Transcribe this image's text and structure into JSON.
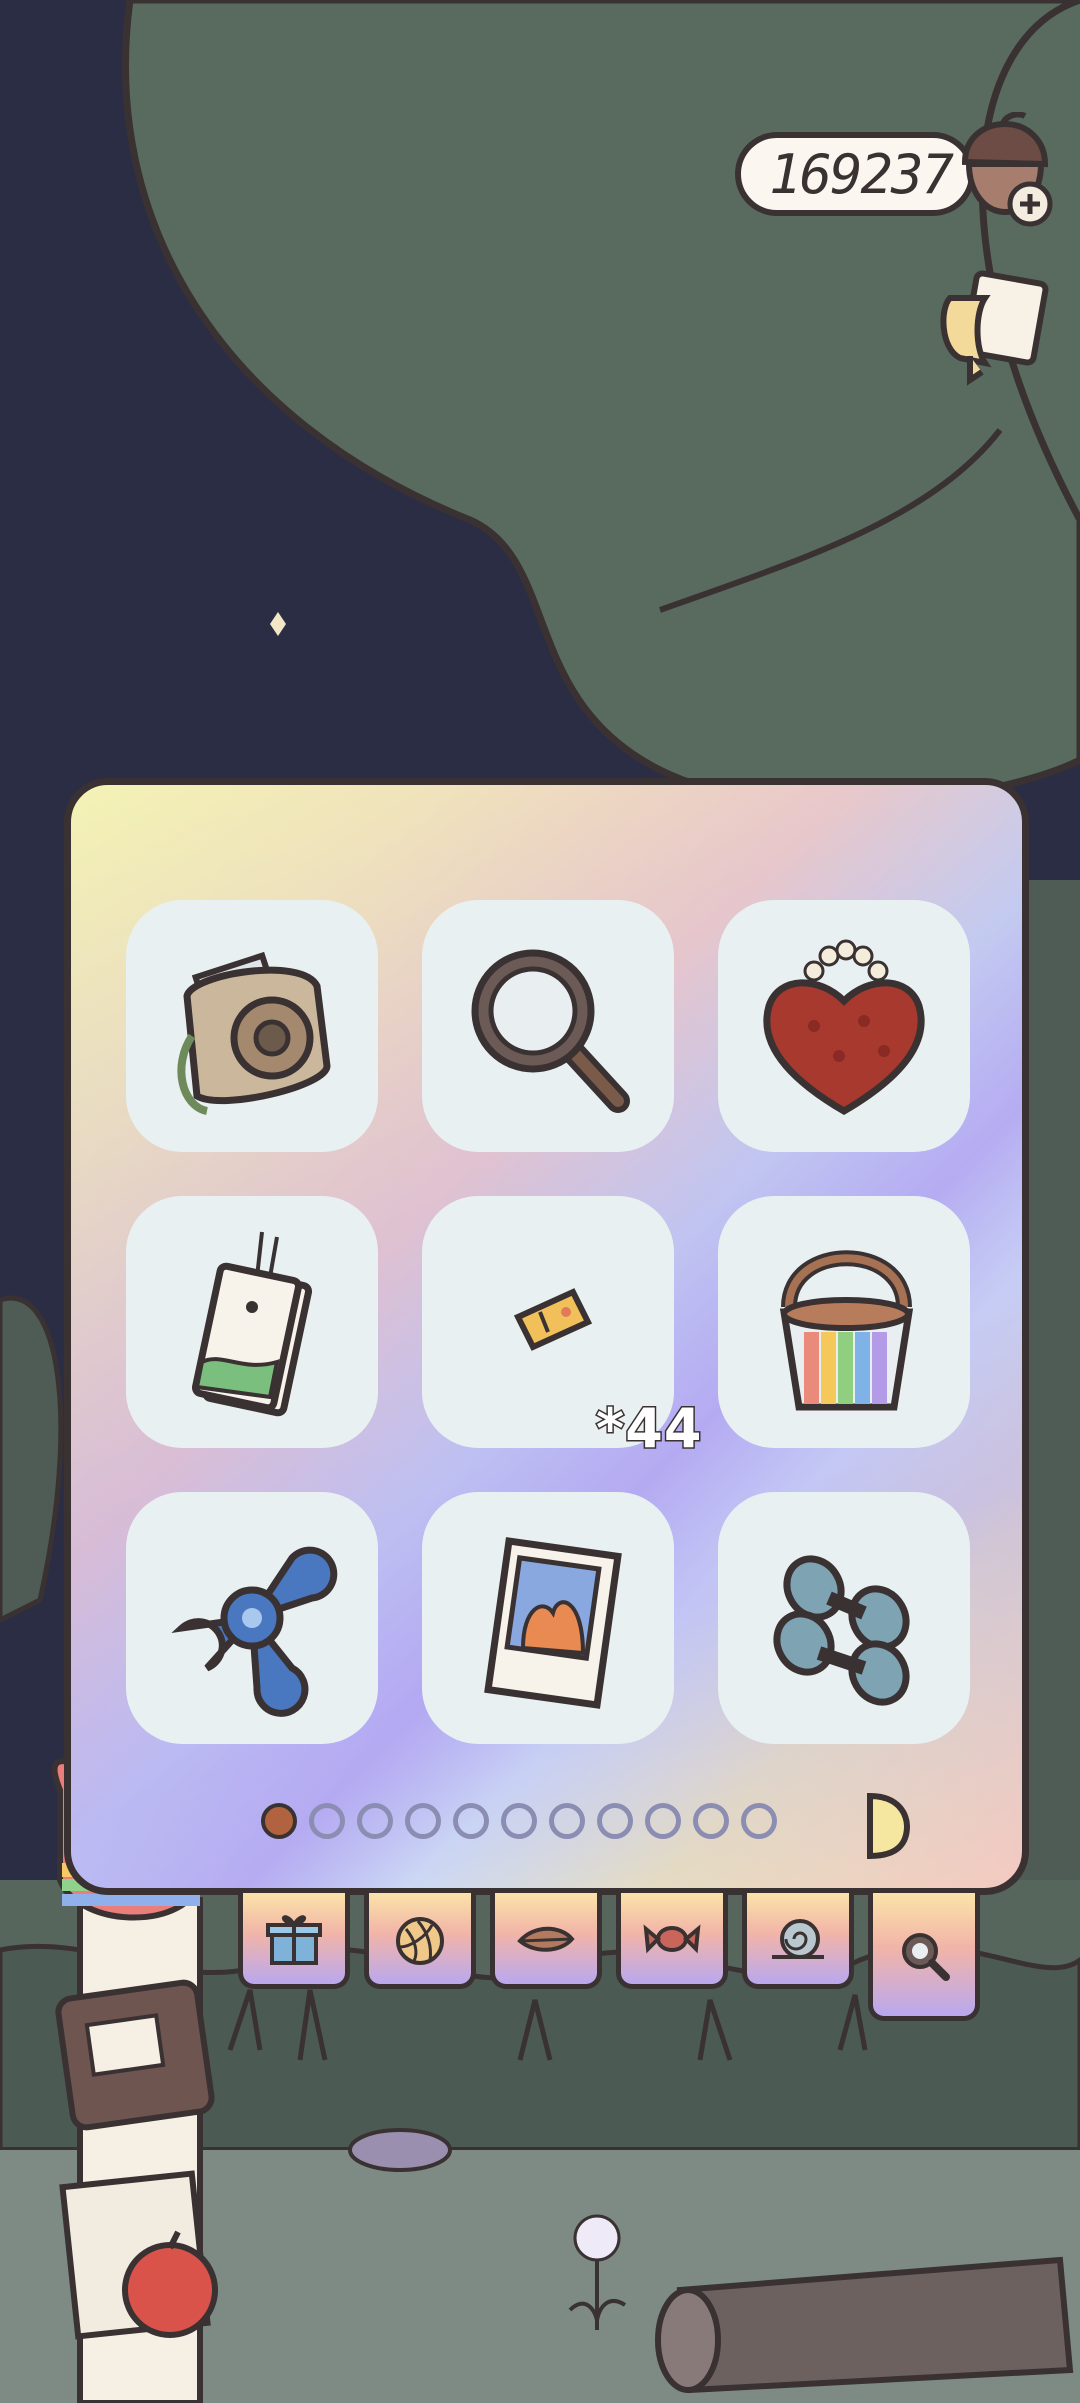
{
  "currency": {
    "amount": "169237",
    "icon": "acorn-icon",
    "add_icon": "plus-icon"
  },
  "quest_icon": "scroll-icon",
  "inventory": {
    "items": [
      {
        "name": "instant-camera",
        "count": ""
      },
      {
        "name": "magnifying-glass",
        "count": ""
      },
      {
        "name": "heart-handbag",
        "count": ""
      },
      {
        "name": "bookmark-tag",
        "count": ""
      },
      {
        "name": "ticket",
        "count": "*44"
      },
      {
        "name": "rainbow-bucket",
        "count": ""
      },
      {
        "name": "fidget-spinner",
        "count": ""
      },
      {
        "name": "photo-card",
        "count": ""
      },
      {
        "name": "dumbbells",
        "count": ""
      }
    ],
    "pagination": {
      "current_page": 1,
      "total_pages": 11
    }
  },
  "tabs": [
    {
      "icon": "gift-icon",
      "active": false
    },
    {
      "icon": "yarn-icon",
      "active": false
    },
    {
      "icon": "leaf-icon",
      "active": false
    },
    {
      "icon": "candy-icon",
      "active": false
    },
    {
      "icon": "snail-icon",
      "active": false
    },
    {
      "icon": "magnifier-icon",
      "active": true
    }
  ],
  "colors": {
    "outline": "#3a3232",
    "slot_bg": "#e9f0f2",
    "night_sky": "#2b2d45",
    "foliage": "#596a5e"
  }
}
